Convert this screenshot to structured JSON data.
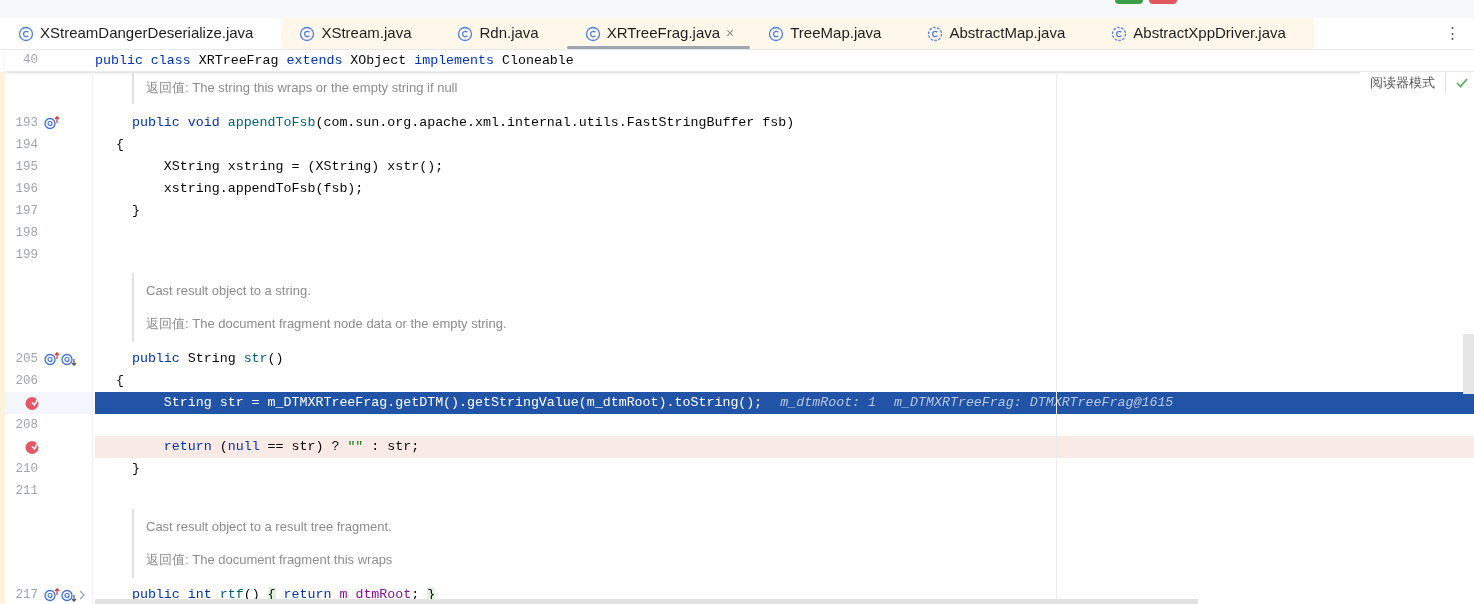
{
  "tabs": [
    {
      "label": "XStreamDangerDeserialize.java",
      "kind": "project_class",
      "selected": false
    },
    {
      "label": "XStream.java",
      "kind": "library_class",
      "selected": false
    },
    {
      "label": "Rdn.java",
      "kind": "library_class",
      "selected": false
    },
    {
      "label": "XRTreeFrag.java",
      "kind": "library_class",
      "selected": true,
      "close": "×"
    },
    {
      "label": "TreeMap.java",
      "kind": "library_class",
      "selected": false
    },
    {
      "label": "AbstractMap.java",
      "kind": "library_abstract",
      "selected": false
    },
    {
      "label": "AbstractXppDriver.java",
      "kind": "library_abstract",
      "selected": false
    }
  ],
  "more_menu": "⋮",
  "sticky_line": {
    "number": "40",
    "tokens": [
      {
        "text": "public class ",
        "kind": "keyword"
      },
      {
        "text": "XRTreeFrag ",
        "kind": "plain"
      },
      {
        "text": "extends ",
        "kind": "keyword"
      },
      {
        "text": "XObject ",
        "kind": "plain"
      },
      {
        "text": "implements ",
        "kind": "keyword"
      },
      {
        "text": "Cloneable",
        "kind": "plain"
      }
    ]
  },
  "reader_mode": {
    "label": "阅读器模式"
  },
  "lines": [
    {
      "kind": "doc",
      "partial": true,
      "texts": [
        "返回值: The string this wraps or the empty string if null"
      ]
    },
    {
      "kind": "code",
      "number": "193",
      "markers": [
        {
          "kind": "overrides"
        }
      ],
      "tokens": [
        {
          "text": "    public void ",
          "kind": "keyword"
        },
        {
          "text": "appendToFsb",
          "kind": "method"
        },
        {
          "text": "(com.sun.org.apache.xml.internal.utils.FastStringBuffer fsb)",
          "kind": "plain"
        }
      ]
    },
    {
      "kind": "code",
      "number": "194",
      "tokens": [
        {
          "text": "  {",
          "kind": "plain"
        }
      ]
    },
    {
      "kind": "code",
      "number": "195",
      "tokens": [
        {
          "text": "        XString xstring = (XString) xstr();",
          "kind": "plain"
        }
      ]
    },
    {
      "kind": "code",
      "number": "196",
      "tokens": [
        {
          "text": "        xstring.appendToFsb(fsb);",
          "kind": "plain"
        }
      ]
    },
    {
      "kind": "code",
      "number": "197",
      "tokens": [
        {
          "text": "    }",
          "kind": "plain"
        }
      ]
    },
    {
      "kind": "code",
      "number": "198"
    },
    {
      "kind": "code",
      "number": "199"
    },
    {
      "kind": "doc",
      "partial": false,
      "texts": [
        "Cast result object to a string.",
        "返回值: The document fragment node data or the empty string."
      ]
    },
    {
      "kind": "code",
      "number": "205",
      "markers": [
        {
          "kind": "overrides"
        },
        {
          "kind": "overridden"
        }
      ],
      "tokens": [
        {
          "text": "    public ",
          "kind": "keyword"
        },
        {
          "text": "String ",
          "kind": "plain"
        },
        {
          "text": "str",
          "kind": "method"
        },
        {
          "text": "()",
          "kind": "plain"
        }
      ]
    },
    {
      "kind": "code",
      "number": "206",
      "tokens": [
        {
          "text": "  {",
          "kind": "plain"
        }
      ]
    },
    {
      "kind": "code",
      "breakpoint": true,
      "current": true,
      "tokens": [
        {
          "text": "        String str = m_DTMXRTreeFrag.getDTM().getStringValue(m_dtmRoot).toString();",
          "kind": "plain"
        }
      ],
      "hints": [
        "m_dtmRoot: 1",
        "m_DTMXRTreeFrag: DTMXRTreeFrag@1615"
      ]
    },
    {
      "kind": "code",
      "number": "208"
    },
    {
      "kind": "code",
      "breakpoint": true,
      "current": false,
      "tokens": [
        {
          "text": "        return ",
          "kind": "keyword"
        },
        {
          "text": "(",
          "kind": "plain"
        },
        {
          "text": "null ",
          "kind": "keyword"
        },
        {
          "text": "== str) ? ",
          "kind": "plain"
        },
        {
          "text": "\"\"",
          "kind": "string"
        },
        {
          "text": " : str;",
          "kind": "plain"
        }
      ]
    },
    {
      "kind": "code",
      "number": "210",
      "tokens": [
        {
          "text": "    }",
          "kind": "plain"
        }
      ]
    },
    {
      "kind": "code",
      "number": "211"
    },
    {
      "kind": "doc",
      "partial": false,
      "texts": [
        "Cast result object to a result tree fragment.",
        "返回值: The document fragment this wraps"
      ]
    },
    {
      "kind": "code",
      "number": "217",
      "markers": [
        {
          "kind": "overrides"
        },
        {
          "kind": "overridden"
        },
        {
          "kind": "fold"
        }
      ],
      "tokens": [
        {
          "text": "    public int ",
          "kind": "keyword"
        },
        {
          "text": "rtf",
          "kind": "method"
        },
        {
          "text": "() ",
          "kind": "plain"
        },
        {
          "text": "{",
          "kind": "brace"
        },
        {
          "text": " return ",
          "kind": "keyword"
        },
        {
          "text": "m_dtmRoot",
          "kind": "field"
        },
        {
          "text": "; ",
          "kind": "plain"
        },
        {
          "text": "}",
          "kind": "brace"
        }
      ]
    }
  ]
}
